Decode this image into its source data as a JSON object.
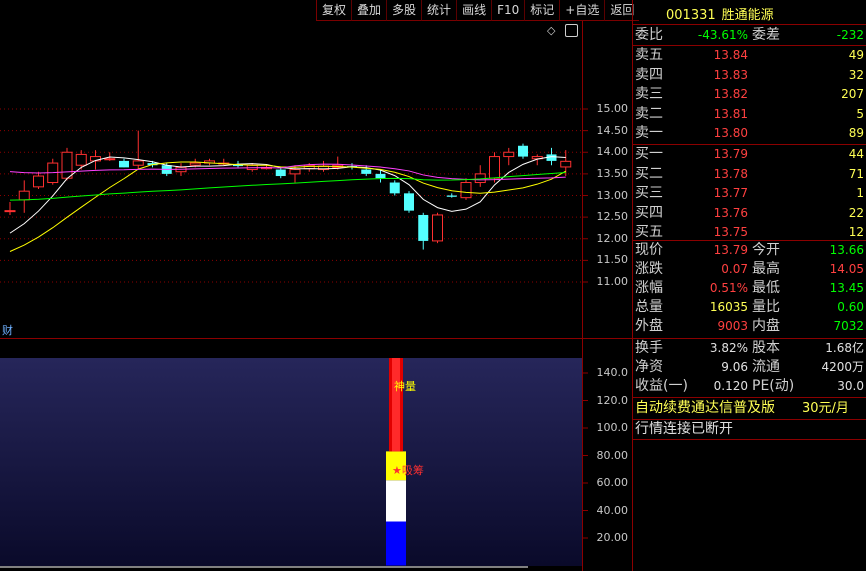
{
  "toolbar": [
    "复权",
    "叠加",
    "多股",
    "统计",
    "画线",
    "F10",
    "标记",
    "+自选",
    "返回"
  ],
  "stock": {
    "code": "001331",
    "name": "胜通能源"
  },
  "weibi": {
    "label": "委比",
    "value": "-43.61%",
    "label2": "委差",
    "value2": "-232"
  },
  "asks": [
    {
      "label": "卖五",
      "price": "13.84",
      "vol": "49"
    },
    {
      "label": "卖四",
      "price": "13.83",
      "vol": "32"
    },
    {
      "label": "卖三",
      "price": "13.82",
      "vol": "207"
    },
    {
      "label": "卖二",
      "price": "13.81",
      "vol": "5"
    },
    {
      "label": "卖一",
      "price": "13.80",
      "vol": "89"
    }
  ],
  "bids": [
    {
      "label": "买一",
      "price": "13.79",
      "vol": "44"
    },
    {
      "label": "买二",
      "price": "13.78",
      "vol": "71"
    },
    {
      "label": "买三",
      "price": "13.77",
      "vol": "1"
    },
    {
      "label": "买四",
      "price": "13.76",
      "vol": "22"
    },
    {
      "label": "买五",
      "price": "13.75",
      "vol": "12"
    }
  ],
  "quote": [
    {
      "l1": "现价",
      "v1": "13.79",
      "c1": "#ff4040",
      "l2": "今开",
      "v2": "13.66",
      "c2": "#00ff00"
    },
    {
      "l1": "涨跌",
      "v1": "0.07",
      "c1": "#ff4040",
      "l2": "最高",
      "v2": "14.05",
      "c2": "#ff4040"
    },
    {
      "l1": "涨幅",
      "v1": "0.51%",
      "c1": "#ff4040",
      "l2": "最低",
      "v2": "13.45",
      "c2": "#00ff00"
    },
    {
      "l1": "总量",
      "v1": "16035",
      "c1": "#ffff55",
      "l2": "量比",
      "v2": "0.60",
      "c2": "#00ff00"
    },
    {
      "l1": "外盘",
      "v1": "9003",
      "c1": "#ff4040",
      "l2": "内盘",
      "v2": "7032",
      "c2": "#00ff00"
    }
  ],
  "fund": [
    {
      "l1": "换手",
      "v1": "3.82%",
      "l2": "股本",
      "v2": "1.68亿"
    },
    {
      "l1": "净资",
      "v1": "9.06",
      "l2": "流通",
      "v2": "4200万"
    },
    {
      "l1": "收益(一)",
      "v1": "0.120",
      "l2": "PE(动)",
      "v2": "30.0"
    }
  ],
  "notice": {
    "text": "自动续费通达信普及版",
    "price": "30元/月"
  },
  "status": "行情连接已断开",
  "fin_label": "财",
  "indicator_labels": {
    "top": "神量",
    "mid": "吸筹"
  },
  "colors": {
    "up": "#ff3030",
    "down": "#54ffff",
    "ma5": "#ffffff",
    "ma10": "#ffff00",
    "ma20": "#ff40ff",
    "ma60": "#00ff00",
    "grid": "#8b0000"
  },
  "chart_data": [
    {
      "type": "candlestick",
      "ylim": [
        10.8,
        15.5
      ],
      "yticks": [
        "15.00",
        "14.50",
        "14.00",
        "13.50",
        "13.00",
        "12.50",
        "12.00",
        "11.50",
        "11.00"
      ],
      "ytick_values": [
        15.0,
        14.5,
        14.0,
        13.5,
        13.0,
        12.5,
        12.0,
        11.5,
        11.0
      ],
      "candles": [
        {
          "o": 12.65,
          "h": 12.85,
          "l": 12.55,
          "c": 12.65
        },
        {
          "o": 12.9,
          "h": 13.35,
          "l": 12.6,
          "c": 13.1
        },
        {
          "o": 13.2,
          "h": 13.55,
          "l": 13.15,
          "c": 13.45
        },
        {
          "o": 13.3,
          "h": 13.85,
          "l": 13.25,
          "c": 13.75
        },
        {
          "o": 13.4,
          "h": 14.1,
          "l": 13.35,
          "c": 14.0
        },
        {
          "o": 13.7,
          "h": 14.05,
          "l": 13.6,
          "c": 13.95
        },
        {
          "o": 13.8,
          "h": 14.05,
          "l": 13.6,
          "c": 13.9
        },
        {
          "o": 13.85,
          "h": 14.0,
          "l": 13.8,
          "c": 13.85
        },
        {
          "o": 13.8,
          "h": 13.85,
          "l": 13.65,
          "c": 13.65
        },
        {
          "o": 13.7,
          "h": 14.5,
          "l": 13.6,
          "c": 13.8
        },
        {
          "o": 13.75,
          "h": 13.8,
          "l": 13.65,
          "c": 13.7
        },
        {
          "o": 13.7,
          "h": 13.75,
          "l": 13.45,
          "c": 13.5
        },
        {
          "o": 13.55,
          "h": 13.75,
          "l": 13.45,
          "c": 13.65
        },
        {
          "o": 13.7,
          "h": 13.85,
          "l": 13.65,
          "c": 13.75
        },
        {
          "o": 13.75,
          "h": 13.85,
          "l": 13.7,
          "c": 13.8
        },
        {
          "o": 13.75,
          "h": 13.85,
          "l": 13.7,
          "c": 13.75
        },
        {
          "o": 13.72,
          "h": 13.8,
          "l": 13.65,
          "c": 13.68
        },
        {
          "o": 13.6,
          "h": 13.75,
          "l": 13.55,
          "c": 13.7
        },
        {
          "o": 13.62,
          "h": 13.7,
          "l": 13.6,
          "c": 13.65
        },
        {
          "o": 13.6,
          "h": 13.65,
          "l": 13.4,
          "c": 13.45
        },
        {
          "o": 13.5,
          "h": 13.7,
          "l": 13.3,
          "c": 13.6
        },
        {
          "o": 13.62,
          "h": 13.75,
          "l": 13.55,
          "c": 13.7
        },
        {
          "o": 13.6,
          "h": 13.8,
          "l": 13.55,
          "c": 13.68
        },
        {
          "o": 13.65,
          "h": 13.9,
          "l": 13.6,
          "c": 13.7
        },
        {
          "o": 13.68,
          "h": 13.75,
          "l": 13.6,
          "c": 13.65
        },
        {
          "o": 13.6,
          "h": 13.7,
          "l": 13.45,
          "c": 13.5
        },
        {
          "o": 13.5,
          "h": 13.6,
          "l": 13.3,
          "c": 13.4
        },
        {
          "o": 13.3,
          "h": 13.35,
          "l": 13.0,
          "c": 13.05
        },
        {
          "o": 13.05,
          "h": 13.1,
          "l": 12.6,
          "c": 12.65
        },
        {
          "o": 12.55,
          "h": 12.6,
          "l": 11.75,
          "c": 11.95
        },
        {
          "o": 11.95,
          "h": 12.6,
          "l": 11.9,
          "c": 12.55
        },
        {
          "o": 13.0,
          "h": 13.05,
          "l": 12.95,
          "c": 12.97
        },
        {
          "o": 12.95,
          "h": 13.4,
          "l": 12.9,
          "c": 13.3
        },
        {
          "o": 13.3,
          "h": 13.7,
          "l": 13.2,
          "c": 13.5
        },
        {
          "o": 13.4,
          "h": 14.0,
          "l": 13.3,
          "c": 13.9
        },
        {
          "o": 13.9,
          "h": 14.1,
          "l": 13.7,
          "c": 14.0
        },
        {
          "o": 14.15,
          "h": 14.2,
          "l": 13.85,
          "c": 13.9
        },
        {
          "o": 13.85,
          "h": 13.95,
          "l": 13.7,
          "c": 13.9
        },
        {
          "o": 13.95,
          "h": 14.1,
          "l": 13.7,
          "c": 13.8
        },
        {
          "o": 13.66,
          "h": 14.05,
          "l": 13.45,
          "c": 13.79
        }
      ]
    },
    {
      "type": "bar",
      "ylim": [
        0,
        150
      ],
      "yticks": [
        "140.0",
        "120.0",
        "100.0",
        "80.00",
        "60.00",
        "40.00",
        "20.00"
      ],
      "ytick_values": [
        140,
        120,
        100,
        80,
        60,
        40,
        20
      ],
      "stack": [
        {
          "from": 0,
          "to": 32,
          "color": "#0000ff"
        },
        {
          "from": 32,
          "to": 62,
          "color": "#ffffff"
        },
        {
          "from": 62,
          "to": 83,
          "color": "#ffff00"
        },
        {
          "from": 83,
          "to": 152,
          "color": "#e00000"
        }
      ]
    }
  ]
}
